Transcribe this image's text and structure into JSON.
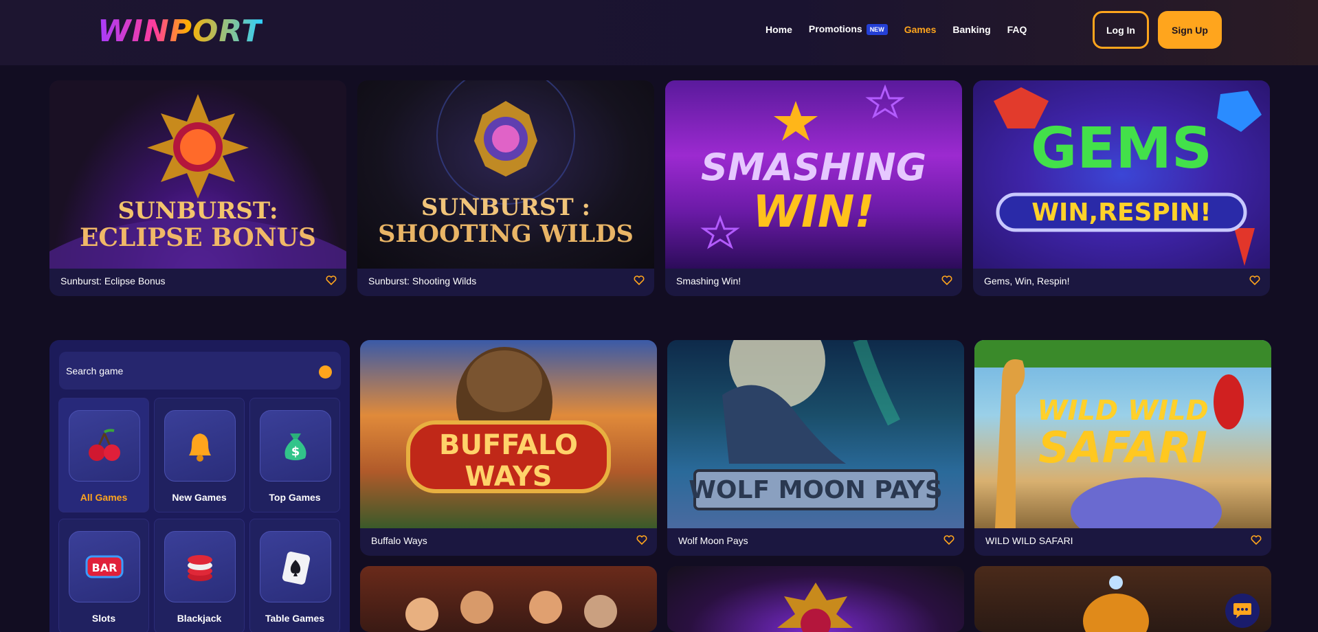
{
  "header": {
    "logo": "WINPORT",
    "nav": [
      {
        "label": "Home",
        "active": false
      },
      {
        "label": "Promotions",
        "badge": "NEW",
        "active": false
      },
      {
        "label": "Games",
        "active": true
      },
      {
        "label": "Banking",
        "active": false
      },
      {
        "label": "FAQ",
        "active": false
      }
    ],
    "login_label": "Log In",
    "signup_label": "Sign Up"
  },
  "featured_games": [
    {
      "title": "Sunburst: Eclipse Bonus",
      "art_line1": "SUNBURST:",
      "art_line2": "ECLIPSE BONUS"
    },
    {
      "title": "Sunburst: Shooting Wilds",
      "art_line1": "SUNBURST :",
      "art_line2": "SHOOTING WILDS"
    },
    {
      "title": "Smashing Win!",
      "art_line1": "SMASHING",
      "art_line2": "WIN!"
    },
    {
      "title": "Gems, Win, Respin!",
      "art_line1": "GEMS",
      "art_line2": "WIN,RESPIN!"
    }
  ],
  "sidebar": {
    "search_placeholder": "Search game",
    "categories": [
      {
        "label": "All Games",
        "icon": "cherry-icon",
        "active": true
      },
      {
        "label": "New Games",
        "icon": "bell-icon",
        "active": false
      },
      {
        "label": "Top Games",
        "icon": "money-bag-icon",
        "active": false
      },
      {
        "label": "Slots",
        "icon": "bar-icon",
        "active": false
      },
      {
        "label": "Blackjack",
        "icon": "chips-icon",
        "active": false
      },
      {
        "label": "Table Games",
        "icon": "spade-card-icon",
        "active": false
      }
    ]
  },
  "grid_games": [
    {
      "title": "Buffalo Ways",
      "art_line1": "BUFFALO",
      "art_line2": "WAYS"
    },
    {
      "title": "Wolf Moon Pays",
      "art_line1": "WOLF MOON PAYS",
      "art_line2": ""
    },
    {
      "title": "WILD WILD SAFARI",
      "art_line1": "WILD WILD",
      "art_line2": "SAFARI"
    }
  ],
  "bar_text": "BAR",
  "colors": {
    "background": "#120d22",
    "accent": "#ffa51d",
    "sidebar": "#1c1b5a",
    "card": "#1b1740",
    "new_badge": "#2440d6"
  }
}
